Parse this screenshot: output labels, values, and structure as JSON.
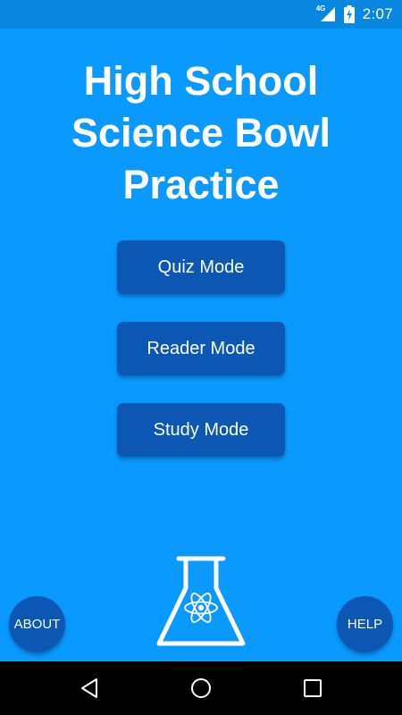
{
  "status_bar": {
    "network_type": "4G",
    "time": "2:07",
    "icons": [
      "signal-icon",
      "battery-charging-icon"
    ]
  },
  "title_lines": [
    "High School",
    "Science Bowl",
    "Practice"
  ],
  "modes": {
    "quiz": "Quiz Mode",
    "reader": "Reader Mode",
    "study": "Study Mode"
  },
  "footer": {
    "about_label": "ABOUT",
    "help_label": "HELP",
    "logo_icon": "atom-flask-icon"
  },
  "nav_bar": {
    "icons": [
      "back-icon",
      "home-icon",
      "recents-icon"
    ]
  },
  "colors": {
    "background": "#0a99ff",
    "status_bar": "#0a87e0",
    "button": "#0c57b4",
    "text": "#ffffff"
  }
}
